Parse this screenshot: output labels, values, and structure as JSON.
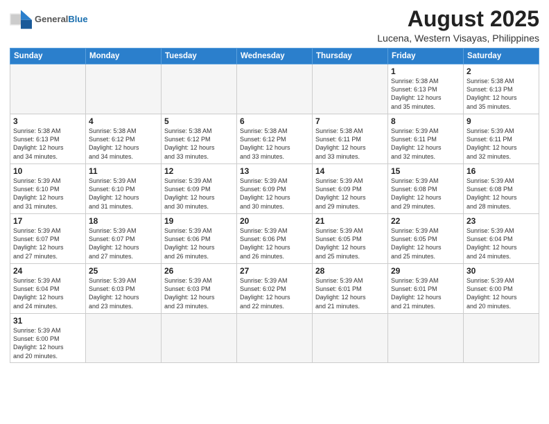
{
  "header": {
    "logo_general": "General",
    "logo_blue": "Blue",
    "month_title": "August 2025",
    "location": "Lucena, Western Visayas, Philippines"
  },
  "days_of_week": [
    "Sunday",
    "Monday",
    "Tuesday",
    "Wednesday",
    "Thursday",
    "Friday",
    "Saturday"
  ],
  "weeks": [
    [
      {
        "day": "",
        "info": ""
      },
      {
        "day": "",
        "info": ""
      },
      {
        "day": "",
        "info": ""
      },
      {
        "day": "",
        "info": ""
      },
      {
        "day": "",
        "info": ""
      },
      {
        "day": "1",
        "info": "Sunrise: 5:38 AM\nSunset: 6:13 PM\nDaylight: 12 hours\nand 35 minutes."
      },
      {
        "day": "2",
        "info": "Sunrise: 5:38 AM\nSunset: 6:13 PM\nDaylight: 12 hours\nand 35 minutes."
      }
    ],
    [
      {
        "day": "3",
        "info": "Sunrise: 5:38 AM\nSunset: 6:13 PM\nDaylight: 12 hours\nand 34 minutes."
      },
      {
        "day": "4",
        "info": "Sunrise: 5:38 AM\nSunset: 6:12 PM\nDaylight: 12 hours\nand 34 minutes."
      },
      {
        "day": "5",
        "info": "Sunrise: 5:38 AM\nSunset: 6:12 PM\nDaylight: 12 hours\nand 33 minutes."
      },
      {
        "day": "6",
        "info": "Sunrise: 5:38 AM\nSunset: 6:12 PM\nDaylight: 12 hours\nand 33 minutes."
      },
      {
        "day": "7",
        "info": "Sunrise: 5:38 AM\nSunset: 6:11 PM\nDaylight: 12 hours\nand 33 minutes."
      },
      {
        "day": "8",
        "info": "Sunrise: 5:39 AM\nSunset: 6:11 PM\nDaylight: 12 hours\nand 32 minutes."
      },
      {
        "day": "9",
        "info": "Sunrise: 5:39 AM\nSunset: 6:11 PM\nDaylight: 12 hours\nand 32 minutes."
      }
    ],
    [
      {
        "day": "10",
        "info": "Sunrise: 5:39 AM\nSunset: 6:10 PM\nDaylight: 12 hours\nand 31 minutes."
      },
      {
        "day": "11",
        "info": "Sunrise: 5:39 AM\nSunset: 6:10 PM\nDaylight: 12 hours\nand 31 minutes."
      },
      {
        "day": "12",
        "info": "Sunrise: 5:39 AM\nSunset: 6:09 PM\nDaylight: 12 hours\nand 30 minutes."
      },
      {
        "day": "13",
        "info": "Sunrise: 5:39 AM\nSunset: 6:09 PM\nDaylight: 12 hours\nand 30 minutes."
      },
      {
        "day": "14",
        "info": "Sunrise: 5:39 AM\nSunset: 6:09 PM\nDaylight: 12 hours\nand 29 minutes."
      },
      {
        "day": "15",
        "info": "Sunrise: 5:39 AM\nSunset: 6:08 PM\nDaylight: 12 hours\nand 29 minutes."
      },
      {
        "day": "16",
        "info": "Sunrise: 5:39 AM\nSunset: 6:08 PM\nDaylight: 12 hours\nand 28 minutes."
      }
    ],
    [
      {
        "day": "17",
        "info": "Sunrise: 5:39 AM\nSunset: 6:07 PM\nDaylight: 12 hours\nand 27 minutes."
      },
      {
        "day": "18",
        "info": "Sunrise: 5:39 AM\nSunset: 6:07 PM\nDaylight: 12 hours\nand 27 minutes."
      },
      {
        "day": "19",
        "info": "Sunrise: 5:39 AM\nSunset: 6:06 PM\nDaylight: 12 hours\nand 26 minutes."
      },
      {
        "day": "20",
        "info": "Sunrise: 5:39 AM\nSunset: 6:06 PM\nDaylight: 12 hours\nand 26 minutes."
      },
      {
        "day": "21",
        "info": "Sunrise: 5:39 AM\nSunset: 6:05 PM\nDaylight: 12 hours\nand 25 minutes."
      },
      {
        "day": "22",
        "info": "Sunrise: 5:39 AM\nSunset: 6:05 PM\nDaylight: 12 hours\nand 25 minutes."
      },
      {
        "day": "23",
        "info": "Sunrise: 5:39 AM\nSunset: 6:04 PM\nDaylight: 12 hours\nand 24 minutes."
      }
    ],
    [
      {
        "day": "24",
        "info": "Sunrise: 5:39 AM\nSunset: 6:04 PM\nDaylight: 12 hours\nand 24 minutes."
      },
      {
        "day": "25",
        "info": "Sunrise: 5:39 AM\nSunset: 6:03 PM\nDaylight: 12 hours\nand 23 minutes."
      },
      {
        "day": "26",
        "info": "Sunrise: 5:39 AM\nSunset: 6:03 PM\nDaylight: 12 hours\nand 23 minutes."
      },
      {
        "day": "27",
        "info": "Sunrise: 5:39 AM\nSunset: 6:02 PM\nDaylight: 12 hours\nand 22 minutes."
      },
      {
        "day": "28",
        "info": "Sunrise: 5:39 AM\nSunset: 6:01 PM\nDaylight: 12 hours\nand 21 minutes."
      },
      {
        "day": "29",
        "info": "Sunrise: 5:39 AM\nSunset: 6:01 PM\nDaylight: 12 hours\nand 21 minutes."
      },
      {
        "day": "30",
        "info": "Sunrise: 5:39 AM\nSunset: 6:00 PM\nDaylight: 12 hours\nand 20 minutes."
      }
    ],
    [
      {
        "day": "31",
        "info": "Sunrise: 5:39 AM\nSunset: 6:00 PM\nDaylight: 12 hours\nand 20 minutes."
      },
      {
        "day": "",
        "info": ""
      },
      {
        "day": "",
        "info": ""
      },
      {
        "day": "",
        "info": ""
      },
      {
        "day": "",
        "info": ""
      },
      {
        "day": "",
        "info": ""
      },
      {
        "day": "",
        "info": ""
      }
    ]
  ]
}
